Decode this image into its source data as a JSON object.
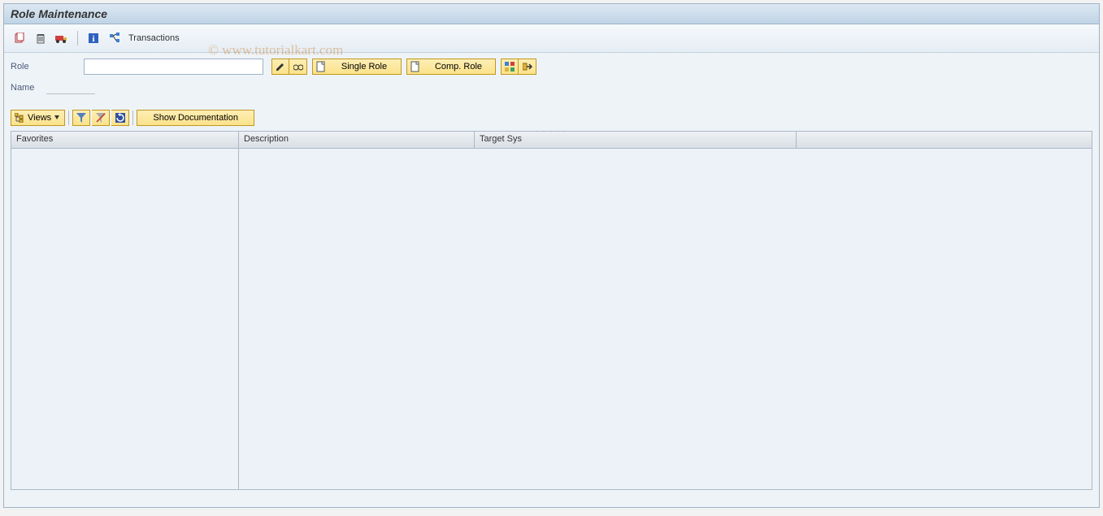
{
  "header": {
    "title": "Role Maintenance"
  },
  "toolbar": {
    "transactions_label": "Transactions"
  },
  "form": {
    "role_label": "Role",
    "role_value": "",
    "name_label": "Name",
    "single_role_label": "Single Role",
    "comp_role_label": "Comp. Role"
  },
  "lower_toolbar": {
    "views_label": "Views",
    "show_doc_label": "Show Documentation"
  },
  "table": {
    "columns": {
      "favorites": "Favorites",
      "description": "Description",
      "target_sys": "Target Sys"
    }
  },
  "watermark": "© www.tutorialkart.com"
}
